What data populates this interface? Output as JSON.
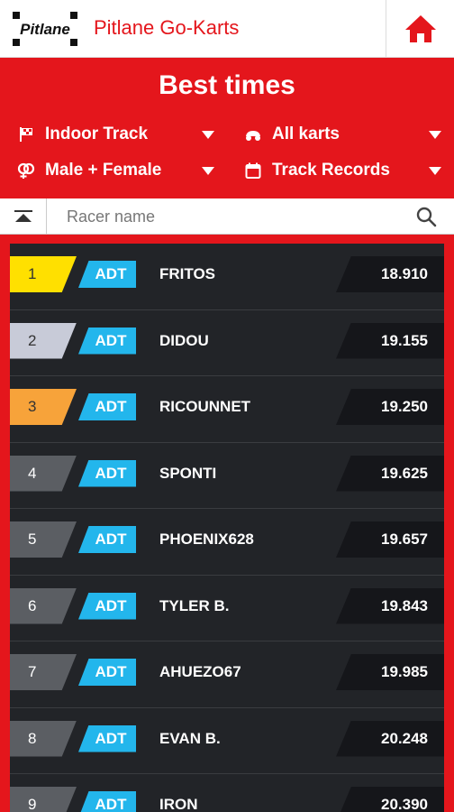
{
  "header": {
    "logo_text": "Pitlane",
    "title": "Pitlane Go-Karts",
    "home_icon": "home-icon"
  },
  "filters": {
    "title": "Best times",
    "track": {
      "label": "Indoor Track",
      "icon": "flag-icon"
    },
    "karts": {
      "label": "All karts",
      "icon": "kart-icon"
    },
    "gender": {
      "label": "Male + Female",
      "icon": "gender-icon"
    },
    "period": {
      "label": "Track Records",
      "icon": "calendar-icon"
    }
  },
  "search": {
    "placeholder": "Racer name",
    "value": ""
  },
  "colors": {
    "brand_red": "#e4161c",
    "gold": "#ffe000",
    "silver": "#c8cbd8",
    "bronze": "#f7a33a",
    "tag_blue": "#23b6ec"
  },
  "results": [
    {
      "rank": "1",
      "tag": "ADT",
      "name": "FRITOS",
      "time": "18.910",
      "medal": "gold"
    },
    {
      "rank": "2",
      "tag": "ADT",
      "name": "DIDOU",
      "time": "19.155",
      "medal": "silver"
    },
    {
      "rank": "3",
      "tag": "ADT",
      "name": "RICOUNNET",
      "time": "19.250",
      "medal": "bronze"
    },
    {
      "rank": "4",
      "tag": "ADT",
      "name": "SPONTI",
      "time": "19.625",
      "medal": "plain"
    },
    {
      "rank": "5",
      "tag": "ADT",
      "name": "PHOENIX628",
      "time": "19.657",
      "medal": "plain"
    },
    {
      "rank": "6",
      "tag": "ADT",
      "name": "TYLER B.",
      "time": "19.843",
      "medal": "plain"
    },
    {
      "rank": "7",
      "tag": "ADT",
      "name": "AHUEZO67",
      "time": "19.985",
      "medal": "plain"
    },
    {
      "rank": "8",
      "tag": "ADT",
      "name": "EVAN B.",
      "time": "20.248",
      "medal": "plain"
    },
    {
      "rank": "9",
      "tag": "ADT",
      "name": "IRON",
      "time": "20.390",
      "medal": "plain"
    }
  ]
}
